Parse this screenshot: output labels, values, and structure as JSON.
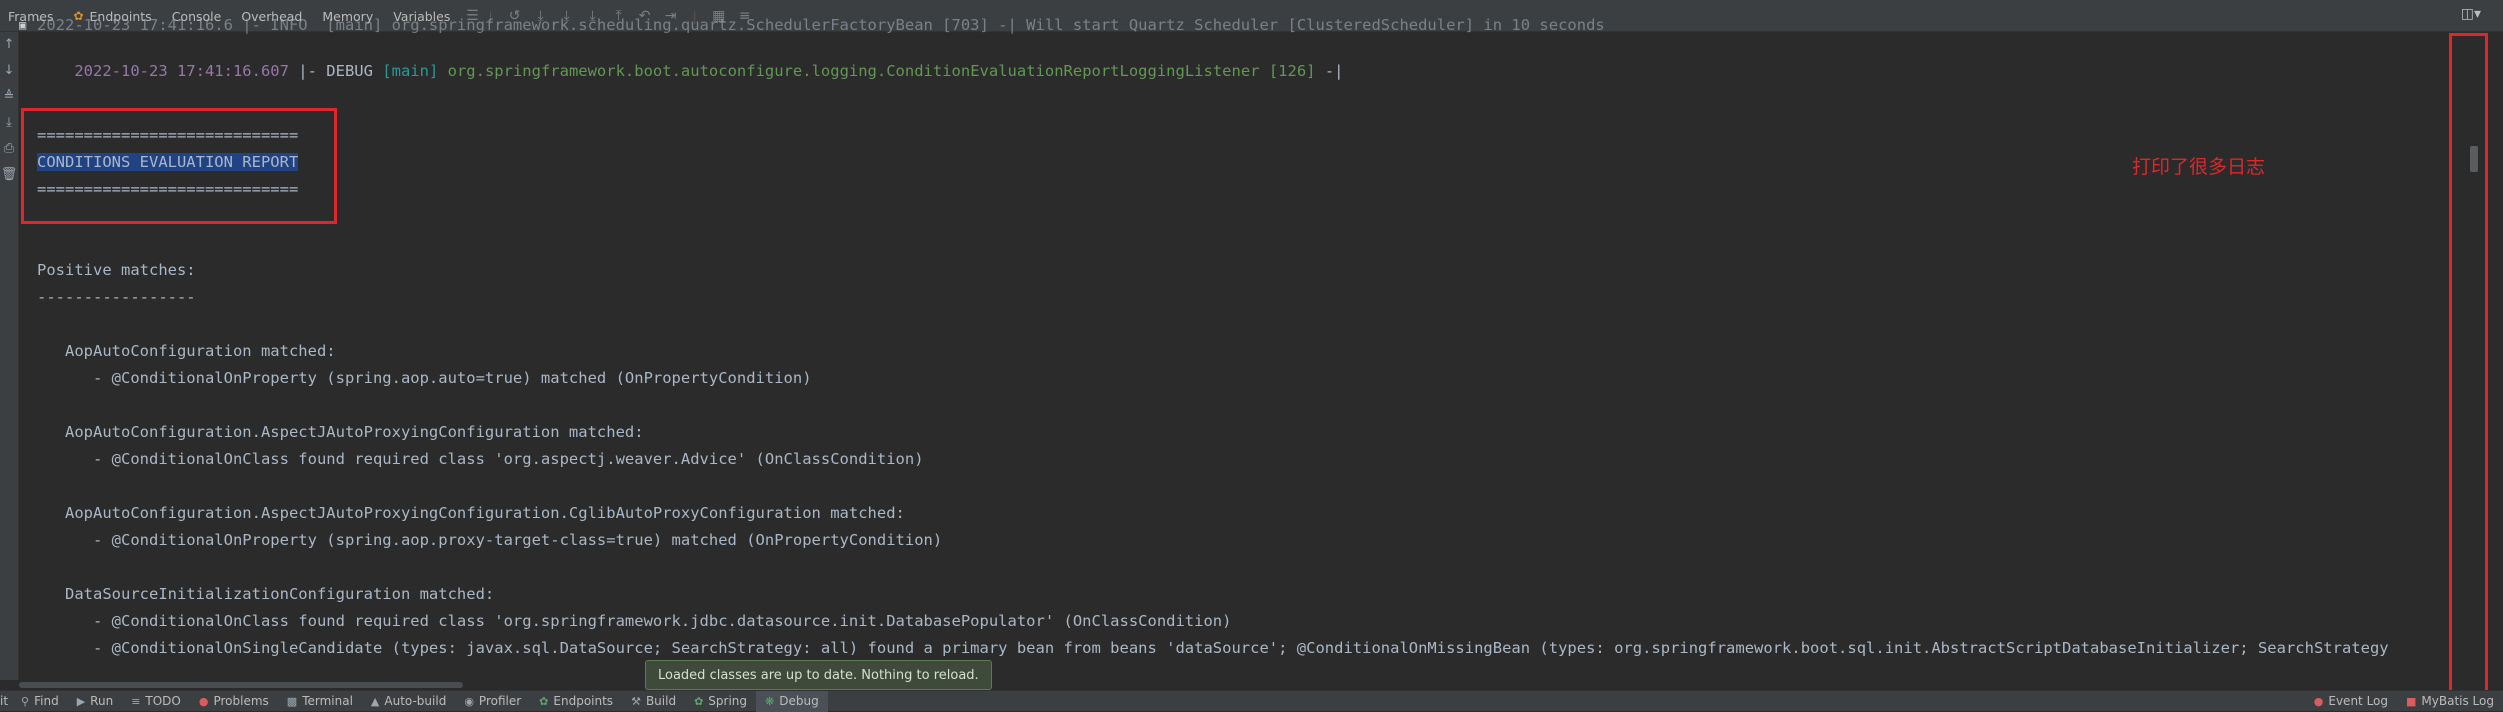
{
  "toolbar": {
    "tabs": [
      {
        "label": "Frames",
        "icon": "frames-icon"
      },
      {
        "label": "Endpoints",
        "icon": "endpoints-icon"
      },
      {
        "label": "Console",
        "icon": "console-icon"
      },
      {
        "label": "Overhead",
        "icon": ""
      },
      {
        "label": "Memory",
        "icon": ""
      },
      {
        "label": "Variables",
        "icon": ""
      }
    ]
  },
  "console": {
    "top_partial": "2022-10-23 17:41:16.6 |- INFO  [main] org.springframework.scheduling.quartz.SchedulerFactoryBean [703] -| Will start Quartz Scheduler [ClusteredScheduler] in 10 seconds",
    "log_line": {
      "timestamp": "2022-10-23 17:41:16.607",
      "level": " |- DEBUG ",
      "thread": "[main]",
      "logger": " org.springframework.boot.autoconfigure.logging.ConditionEvaluationReportLoggingListener [126]",
      "suffix": " -|"
    },
    "lines": [
      "============================",
      "CONDITIONS EVALUATION REPORT",
      "============================",
      "Positive matches:",
      "-----------------",
      "   AopAutoConfiguration matched:",
      "      - @ConditionalOnProperty (spring.aop.auto=true) matched (OnPropertyCondition)",
      "   AopAutoConfiguration.AspectJAutoProxyingConfiguration matched:",
      "      - @ConditionalOnClass found required class 'org.aspectj.weaver.Advice' (OnClassCondition)",
      "   AopAutoConfiguration.AspectJAutoProxyingConfiguration.CglibAutoProxyConfiguration matched:",
      "      - @ConditionalOnProperty (spring.aop.proxy-target-class=true) matched (OnPropertyCondition)",
      "   DataSourceInitializationConfiguration matched:",
      "      - @ConditionalOnClass found required class 'org.springframework.jdbc.datasource.init.DatabasePopulator' (OnClassCondition)",
      "      - @ConditionalOnSingleCandidate (types: javax.sql.DataSource; SearchStrategy: all) found a primary bean from beans 'dataSource'; @ConditionalOnMissingBean (types: org.springframework.boot.sql.init.AbstractScriptDatabaseInitializer; SearchStrategy"
    ]
  },
  "annotation": {
    "note": "打印了很多日志"
  },
  "toast": {
    "text": "Loaded classes are up to date. Nothing to reload."
  },
  "statusbar": {
    "left_cut": "it",
    "items": [
      {
        "label": "Find",
        "icon": "search-icon"
      },
      {
        "label": "Run",
        "icon": "run-icon"
      },
      {
        "label": "TODO",
        "icon": "todo-icon"
      },
      {
        "label": "Problems",
        "icon": "problems-icon"
      },
      {
        "label": "Terminal",
        "icon": "terminal-icon"
      },
      {
        "label": "Auto-build",
        "icon": "auto-build-icon"
      },
      {
        "label": "Profiler",
        "icon": "profiler-icon"
      },
      {
        "label": "Endpoints",
        "icon": "endpoints-icon"
      },
      {
        "label": "Build",
        "icon": "build-icon"
      },
      {
        "label": "Spring",
        "icon": "spring-icon"
      },
      {
        "label": "Debug",
        "icon": "debug-icon"
      }
    ],
    "right_items": [
      {
        "label": "Event Log",
        "icon": "event-log-icon"
      },
      {
        "label": "MyBatis Log",
        "icon": "mybatis-log-icon"
      }
    ]
  },
  "colors": {
    "timestamp": "#9876aa",
    "thread": "#299999",
    "logger": "#629755",
    "annotation_red": "#e0262a",
    "selection": "#214283"
  }
}
